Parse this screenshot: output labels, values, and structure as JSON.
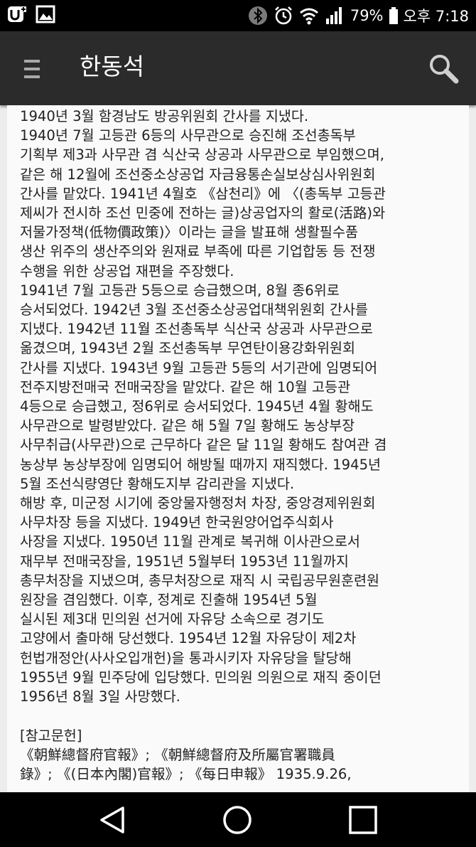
{
  "status_bar": {
    "battery": "79%",
    "time": "오후 7:18",
    "icons": [
      "u-plus-icon",
      "gallery-icon",
      "bluetooth-icon",
      "alarm-icon",
      "wifi-icon",
      "signal-icon",
      "battery-icon"
    ]
  },
  "app_bar": {
    "title": "한동석",
    "menu_icon": "hamburger-menu-icon",
    "search_icon": "search-icon"
  },
  "article": {
    "lines": [
      "1940년 3월 함경남도 방공위원회 간사를 지냈다.",
      "1940년 7월 고등관 6등의 사무관으로 승진해 조선총독부",
      "기획부 제3과 사무관 겸 식산국 상공과 사무관으로 부임했으며,",
      "같은 해 12월에 조선중소상공업 자금융통손실보상심사위원회",
      "간사를 맡았다. 1941년 4월호 《삼천리》에 〈(총독부 고등관",
      "제씨가 전시하 조선 민중에 전하는 글)상공업자의 활로(活路)와",
      "저물가정책(低物價政策)〉이라는 글을 발표해 생활필수품",
      "생산 위주의 생산주의와 원재료 부족에 따른 기업합동 등 전쟁",
      "수행을 위한 상공업 재편을 주장했다.",
      "1941년 7월 고등관 5등으로 승급했으며, 8월 종6위로",
      "승서되었다. 1942년 3월 조선중소상공업대책위원회 간사를",
      "지냈다. 1942년 11월 조선총독부 식산국 상공과 사무관으로",
      "옮겼으며, 1943년 2월 조선총독부 무연탄이용강화위원회",
      "간사를 지냈다. 1943년 9월 고등관 5등의 서기관에 임명되어",
      "전주지방전매국 전매국장을 맡았다. 같은 해 10월 고등관",
      "4등으로 승급했고, 정6위로 승서되었다. 1945년 4월 황해도",
      "사무관으로 발령받았다. 같은 해 5월 7일 황해도 농상부장",
      "사무취급(사무관)으로 근무하다 같은 달 11일 황해도 참여관 겸",
      "농상부 농상부장에 임명되어 해방될 때까지 재직했다. 1945년",
      "5월 조선식량영단 황해도지부 감리관을 지냈다.",
      "해방 후, 미군정 시기에 중앙물자행정처 차장, 중앙경제위원회",
      "사무차장 등을 지냈다. 1949년 한국원양어업주식회사",
      "사장을 지냈다. 1950년 11월 관계로 복귀해 이사관으로서",
      "재무부 전매국장을, 1951년 5월부터 1953년 11월까지",
      "총무처장을 지냈으며, 총무처장으로 재직 시 국립공무원훈련원",
      "원장을 겸임했다. 이후, 정계로 진출해 1954년 5월",
      "실시된 제3대 민의원 선거에 자유당 소속으로 경기도",
      "고양에서 출마해 당선했다. 1954년 12월 자유당이 제2차",
      "헌법개정안(사사오입개헌)을 통과시키자 자유당을 탈당해",
      "1955년 9월 민주당에 입당했다. 민의원 의원으로 재직 중이던",
      "1956년 8월 3일 사망했다.",
      "",
      "[참고문헌]",
      "《朝鮮總督府官報》; 《朝鮮總督府及所屬官署職員",
      "錄》; 《(日本內閣)官報》; 《每日申報》 1935.9.26,"
    ]
  },
  "nav_bar": {
    "icons": [
      "back-icon",
      "home-icon",
      "recent-apps-icon"
    ]
  }
}
